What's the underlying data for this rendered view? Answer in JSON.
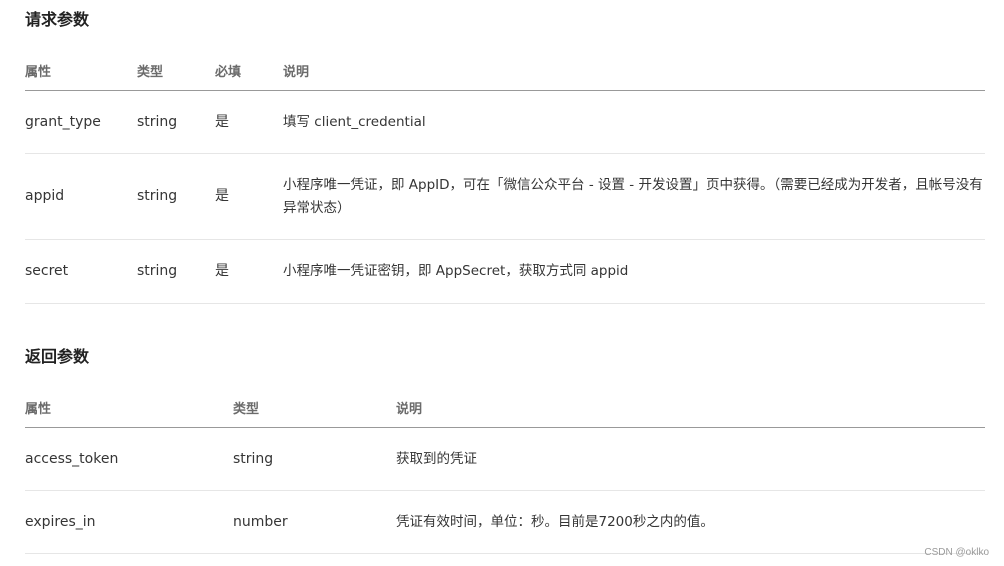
{
  "request_section": {
    "title": "请求参数",
    "headers": {
      "attr": "属性",
      "type": "类型",
      "required": "必填",
      "desc": "说明"
    },
    "rows": [
      {
        "attr": "grant_type",
        "type": "string",
        "required": "是",
        "desc": "填写 client_credential"
      },
      {
        "attr": "appid",
        "type": "string",
        "required": "是",
        "desc": "小程序唯一凭证，即 AppID，可在「微信公众平台 - 设置 - 开发设置」页中获得。（需要已经成为开发者，且帐号没有异常状态）"
      },
      {
        "attr": "secret",
        "type": "string",
        "required": "是",
        "desc": "小程序唯一凭证密钥，即 AppSecret，获取方式同 appid"
      }
    ]
  },
  "response_section": {
    "title": "返回参数",
    "headers": {
      "attr": "属性",
      "type": "类型",
      "desc": "说明"
    },
    "rows": [
      {
        "attr": "access_token",
        "type": "string",
        "desc": "获取到的凭证"
      },
      {
        "attr": "expires_in",
        "type": "number",
        "desc": "凭证有效时间，单位：秒。目前是7200秒之内的值。"
      }
    ]
  },
  "watermark": "CSDN @oklko"
}
